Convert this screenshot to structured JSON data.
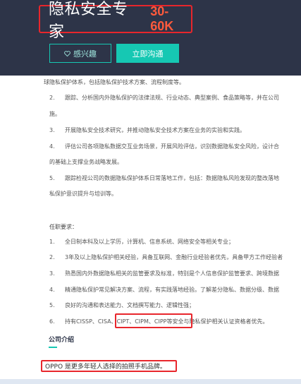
{
  "header": {
    "job_title": "隐私安全专家",
    "salary": "30-60K",
    "interest_icon": "heart-icon",
    "interest_label": "感兴趣",
    "chat_label": "立即沟通"
  },
  "responsibilities": [
    {
      "num": "",
      "text": "球隐私保护体系，包括隐私保护技术方案、流程制度等。"
    },
    {
      "num": "2.",
      "text": "跟踪、分析国内外隐私保护的法律法规、行业动态、典型案例、食品策略等，并在公司"
    },
    {
      "num": "",
      "text": "施。"
    },
    {
      "num": "3.",
      "text": "开展隐私安全技术研究，并推动隐私安全技术方案在业务的实验和实践。"
    },
    {
      "num": "4.",
      "text": "评估公司各项隐私数据交互业务场景，开展风险评估，识别数据隐私安全风险，设计合"
    },
    {
      "num": "",
      "text": "的基础上支撑业务战略发展。"
    },
    {
      "num": "5.",
      "text": "跟踪检视公司的数据隐私保护体系日常落地工作，包括：数据隐私风险发现的整改落地"
    },
    {
      "num": "",
      "text": "私保护意识提升与培训等。"
    }
  ],
  "requirements_title": "任职要求：",
  "requirements": [
    {
      "num": "1.",
      "text": "全日制本科及以上学历，计算机、信息系统、网络安全等相关专业；"
    },
    {
      "num": "2.",
      "text": "3年及以上隐私保护相关经验，具备互联网、金融行业经验者优先，具备甲方工作经验者"
    },
    {
      "num": "3.",
      "text": "熟悉国内外数据隐私相关的监管要求及标准，特别是个人信息保护监管要求、跨境数据"
    },
    {
      "num": "4.",
      "text": "精通隐私保护常见解决方案、流程，有实践落地经验。了解差分隐私、数据分级、数据"
    },
    {
      "num": "5.",
      "text": "良好的沟通和表达能力、文档撰写能力、逻辑性强；"
    },
    {
      "num": "6.",
      "text": "持有CISSP、CISA、CIPT、CIPM、CIPP等安全与隐私保护相关认证资格者优先。"
    }
  ],
  "company": {
    "title": "公司介绍",
    "description": "OPPO 是更多年轻人选择的拍照手机品牌。"
  }
}
